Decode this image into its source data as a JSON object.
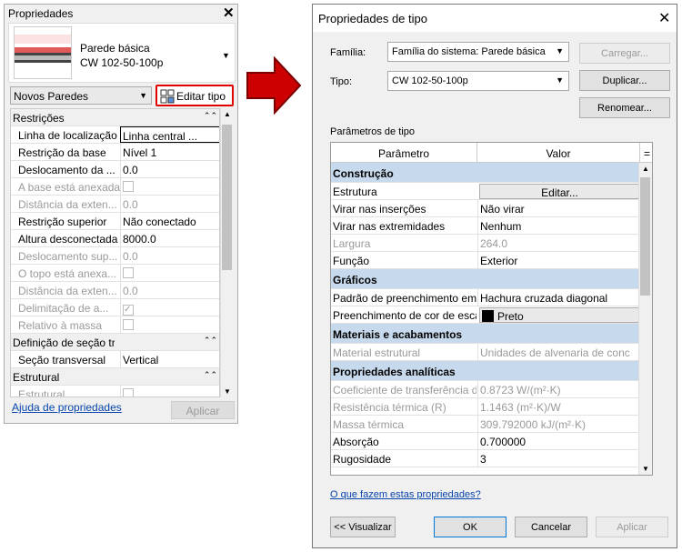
{
  "palette": {
    "title": "Propriedades",
    "close": "✕",
    "type_family": "Parede básica",
    "type_name": "CW 102-50-100p",
    "instance_selector": "Novos Paredes",
    "edit_type_label": "Editar tipo",
    "help_link": "Ajuda de propriedades",
    "apply_label": "Aplicar",
    "rows": [
      {
        "kind": "section",
        "label": "Restrições",
        "icon": "⌃⌃"
      },
      {
        "kind": "prop",
        "label": "Linha de localização",
        "value": "Linha central ..."
      },
      {
        "kind": "prop",
        "label": "Restrição da base",
        "value": "Nível 1"
      },
      {
        "kind": "prop",
        "label": "Deslocamento da ...",
        "value": "0.0"
      },
      {
        "kind": "dim",
        "label": "A base está anexada",
        "value": "",
        "checkbox": true
      },
      {
        "kind": "dim",
        "label": "Distância da exten...",
        "value": "0.0"
      },
      {
        "kind": "prop",
        "label": "Restrição superior",
        "value": "Não conectado"
      },
      {
        "kind": "prop",
        "label": "Altura desconectada",
        "value": "8000.0"
      },
      {
        "kind": "dim",
        "label": "Deslocamento sup...",
        "value": "0.0"
      },
      {
        "kind": "dim",
        "label": "O topo está anexa...",
        "value": "",
        "checkbox": true
      },
      {
        "kind": "dim",
        "label": "Distância da exten...",
        "value": "0.0"
      },
      {
        "kind": "dim",
        "label": "Delimitação de a...",
        "value": "",
        "checkbox": true,
        "checked": true
      },
      {
        "kind": "dim",
        "label": "Relativo à massa",
        "value": "",
        "checkbox": true
      },
      {
        "kind": "section",
        "label": "Definição de seção transversal",
        "icon": "⌃⌃"
      },
      {
        "kind": "prop",
        "label": "Seção transversal",
        "value": "Vertical"
      },
      {
        "kind": "section",
        "label": "Estrutural",
        "icon": "⌃⌃"
      },
      {
        "kind": "dim",
        "label": "Estrutural",
        "value": "",
        "checkbox": true
      }
    ]
  },
  "dialog": {
    "title": "Propriedades de tipo",
    "close": "✕",
    "family_label": "Família:",
    "family_value": "Família do sistema: Parede básica",
    "type_label": "Tipo:",
    "type_value": "CW 102-50-100p",
    "load_button": "Carregar...",
    "duplicate_button": "Duplicar...",
    "rename_button": "Renomear...",
    "params_label": "Parâmetros de tipo",
    "col_param": "Parâmetro",
    "col_value": "Valor",
    "col_eq": "=",
    "rows": [
      {
        "kind": "section",
        "label": "Construção"
      },
      {
        "kind": "button",
        "label": "Estrutura",
        "value": "Editar..."
      },
      {
        "kind": "prop",
        "label": "Virar nas inserções",
        "value": "Não virar"
      },
      {
        "kind": "prop",
        "label": "Virar nas extremidades",
        "value": "Nenhum"
      },
      {
        "kind": "dim",
        "label": "Largura",
        "value": "264.0"
      },
      {
        "kind": "prop",
        "label": "Função",
        "value": "Exterior"
      },
      {
        "kind": "section",
        "label": "Gráficos"
      },
      {
        "kind": "prop",
        "label": "Padrão de preenchimento em",
        "value": "Hachura cruzada diagonal"
      },
      {
        "kind": "color",
        "label": "Preenchimento de cor de esca",
        "value": "Preto",
        "swatch": "#000000"
      },
      {
        "kind": "section",
        "label": "Materiais e acabamentos"
      },
      {
        "kind": "dim",
        "label": "Material estrutural",
        "value": "Unidades de alvenaria de conc"
      },
      {
        "kind": "section",
        "label": "Propriedades analíticas"
      },
      {
        "kind": "dim",
        "label": "Coeficiente de transferência d",
        "value": "0.8723 W/(m²·K)"
      },
      {
        "kind": "dim",
        "label": "Resistência térmica (R)",
        "value": "1.1463 (m²·K)/W"
      },
      {
        "kind": "dim",
        "label": "Massa térmica",
        "value": "309.792000 kJ/(m²·K)"
      },
      {
        "kind": "prop",
        "label": "Absorção",
        "value": "0.700000"
      },
      {
        "kind": "prop",
        "label": "Rugosidade",
        "value": "3"
      }
    ],
    "what_link": "O que fazem estas propriedades?",
    "preview_button": "<< Visualizar",
    "ok_button": "OK",
    "cancel_button": "Cancelar",
    "apply_button": "Aplicar"
  },
  "colors": {
    "highlight_border": "#e00000",
    "arrow": "#cc0000",
    "section_blue": "#c7d9ec",
    "link": "#0645ad"
  }
}
